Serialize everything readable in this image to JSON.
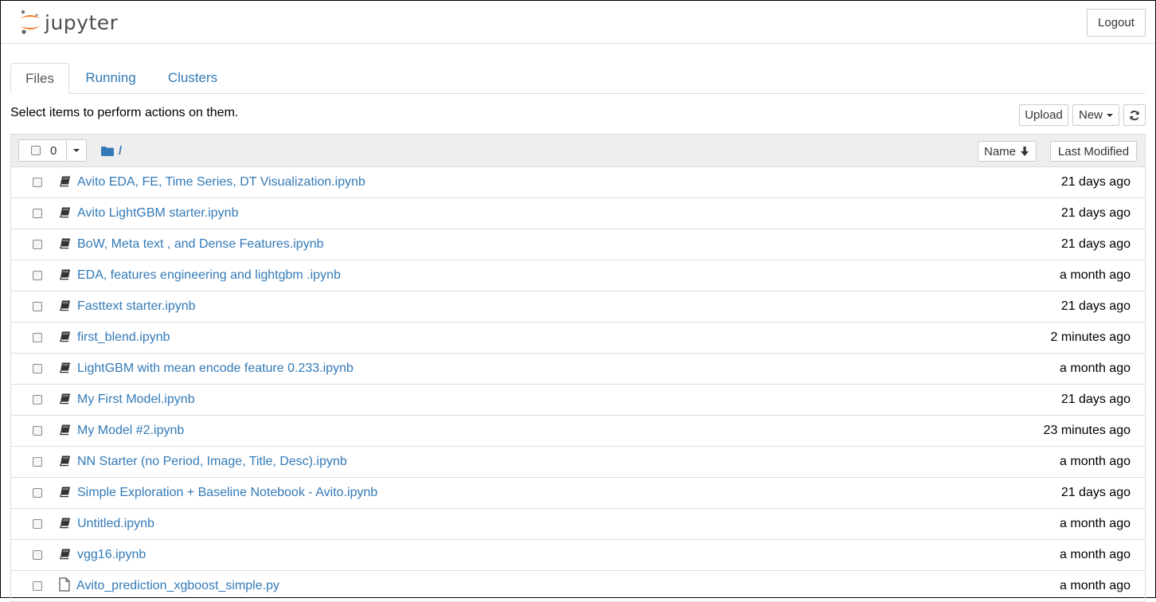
{
  "header": {
    "logo_text": "jupyter",
    "logout_label": "Logout"
  },
  "tabs": [
    {
      "label": "Files",
      "active": true
    },
    {
      "label": "Running",
      "active": false
    },
    {
      "label": "Clusters",
      "active": false
    }
  ],
  "toolbar": {
    "hint": "Select items to perform actions on them.",
    "upload_label": "Upload",
    "new_label": "New",
    "refresh_icon": "refresh-icon"
  },
  "list_header": {
    "selected_count": "0",
    "breadcrumb": "/",
    "sort_name_label": "Name",
    "sort_modified_label": "Last Modified"
  },
  "files": [
    {
      "name": "Avito EDA, FE, Time Series, DT Visualization.ipynb",
      "modified": "21 days ago",
      "type": "notebook"
    },
    {
      "name": "Avito LightGBM starter.ipynb",
      "modified": "21 days ago",
      "type": "notebook"
    },
    {
      "name": "BoW, Meta text , and Dense Features.ipynb",
      "modified": "21 days ago",
      "type": "notebook"
    },
    {
      "name": "EDA, features engineering and lightgbm .ipynb",
      "modified": "a month ago",
      "type": "notebook"
    },
    {
      "name": "Fasttext starter.ipynb",
      "modified": "21 days ago",
      "type": "notebook"
    },
    {
      "name": "first_blend.ipynb",
      "modified": "2 minutes ago",
      "type": "notebook"
    },
    {
      "name": "LightGBM with mean encode feature 0.233.ipynb",
      "modified": "a month ago",
      "type": "notebook"
    },
    {
      "name": "My First Model.ipynb",
      "modified": "21 days ago",
      "type": "notebook"
    },
    {
      "name": "My Model #2.ipynb",
      "modified": "23 minutes ago",
      "type": "notebook"
    },
    {
      "name": "NN Starter (no Period, Image, Title, Desc).ipynb",
      "modified": "a month ago",
      "type": "notebook"
    },
    {
      "name": "Simple Exploration + Baseline Notebook - Avito.ipynb",
      "modified": "21 days ago",
      "type": "notebook"
    },
    {
      "name": "Untitled.ipynb",
      "modified": "a month ago",
      "type": "notebook"
    },
    {
      "name": "vgg16.ipynb",
      "modified": "a month ago",
      "type": "notebook"
    },
    {
      "name": "Avito_prediction_xgboost_simple.py",
      "modified": "a month ago",
      "type": "file"
    }
  ],
  "colors": {
    "link": "#337ab7",
    "logo_orange": "#f37726"
  }
}
